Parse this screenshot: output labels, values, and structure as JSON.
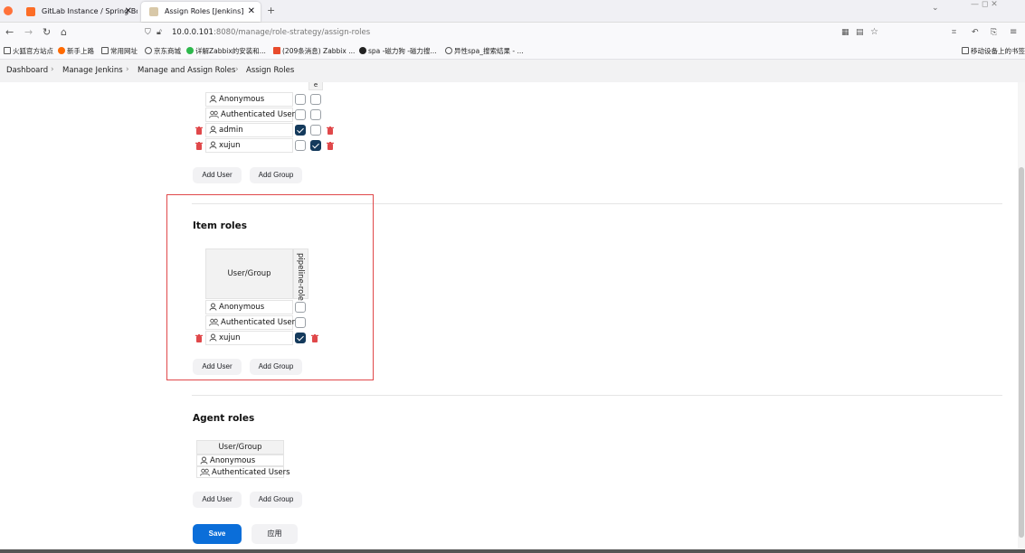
{
  "browser": {
    "tabs": [
      {
        "title": "GitLab Instance / Spring Boo",
        "active": false
      },
      {
        "title": "Assign Roles [Jenkins]",
        "active": true
      }
    ],
    "new_tab": "+",
    "url_host": "10.0.0.101",
    "url_rest": ":8080/manage/role-strategy/assign-roles",
    "bookmarks": [
      "火狐官方站点",
      "新手上路",
      "常用网址",
      "京东商城",
      "详解Zabbix的安装和...",
      "(209条消息) Zabbix ...",
      "spa -磁力狗 -磁力搜...",
      "异性spa_搜索结果 - ...",
      "移动设备上的书签"
    ]
  },
  "breadcrumb": [
    "Dashboard",
    "Manage Jenkins",
    "Manage and Assign Roles",
    "Assign Roles"
  ],
  "global_roles": {
    "header_fragment": "e",
    "rows": [
      {
        "name": "Anonymous",
        "type": "user",
        "checks": [
          false,
          false
        ],
        "deletable": false
      },
      {
        "name": "Authenticated Users",
        "type": "group",
        "checks": [
          false,
          false
        ],
        "deletable": false
      },
      {
        "name": "admin",
        "type": "user",
        "checks": [
          true,
          false
        ],
        "deletable": true
      },
      {
        "name": "xujun",
        "type": "user",
        "checks": [
          false,
          true
        ],
        "deletable": true
      }
    ],
    "add_user": "Add User",
    "add_group": "Add Group"
  },
  "item_roles": {
    "title": "Item roles",
    "column_header": "User/Group",
    "role_header": "pipeline-role",
    "rows": [
      {
        "name": "Anonymous",
        "type": "user",
        "checked": false,
        "deletable": false
      },
      {
        "name": "Authenticated Users",
        "type": "group",
        "checked": false,
        "deletable": false
      },
      {
        "name": "xujun",
        "type": "user",
        "checked": true,
        "deletable": true
      }
    ],
    "add_user": "Add User",
    "add_group": "Add Group"
  },
  "agent_roles": {
    "title": "Agent roles",
    "column_header": "User/Group",
    "rows": [
      {
        "name": "Anonymous",
        "type": "user"
      },
      {
        "name": "Authenticated Users",
        "type": "group"
      }
    ],
    "add_user": "Add User",
    "add_group": "Add Group"
  },
  "actions": {
    "save": "Save",
    "apply": "应用"
  },
  "colors": {
    "accent": "#0b6ed9",
    "checked": "#143a5c",
    "delete": "#e0484a",
    "highlight": "#e0484a"
  }
}
